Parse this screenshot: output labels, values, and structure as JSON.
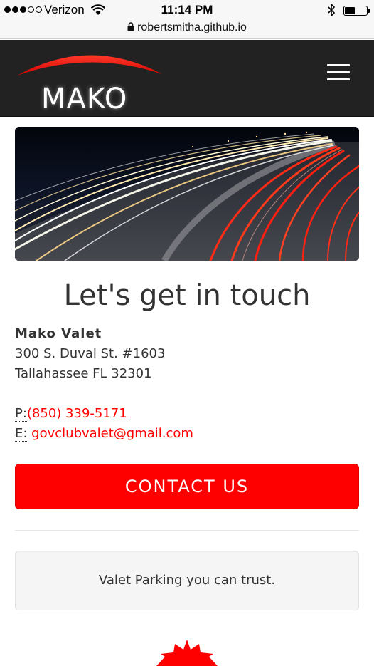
{
  "status_bar": {
    "carrier": "Verizon",
    "signal_strength": 3,
    "signal_max": 5,
    "time": "11:14 PM",
    "battery_level_percent": 45
  },
  "browser": {
    "url": "robertsmitha.github.io"
  },
  "navbar": {
    "logo_text": "MAKO",
    "brand_color": "#ff0000",
    "menu_icon": "hamburger-icon"
  },
  "hero": {
    "image_subject": "long-exposure highway light trails at night"
  },
  "main": {
    "heading": "Let's get in touch",
    "company_name": "Mako Valet",
    "address_line1": "300 S. Duval St. #1603",
    "address_line2": "Tallahassee FL 32301",
    "phone_label": "P:",
    "phone": "(850) 339-5171",
    "email_label": "E:",
    "email": "govclubvalet@gmail.com",
    "contact_button": "CONTACT US",
    "tagline": "Valet Parking you can trust."
  },
  "colors": {
    "accent": "#ff0000",
    "navbar_bg": "#222222",
    "text": "#333333",
    "well_bg": "#f5f5f5"
  }
}
